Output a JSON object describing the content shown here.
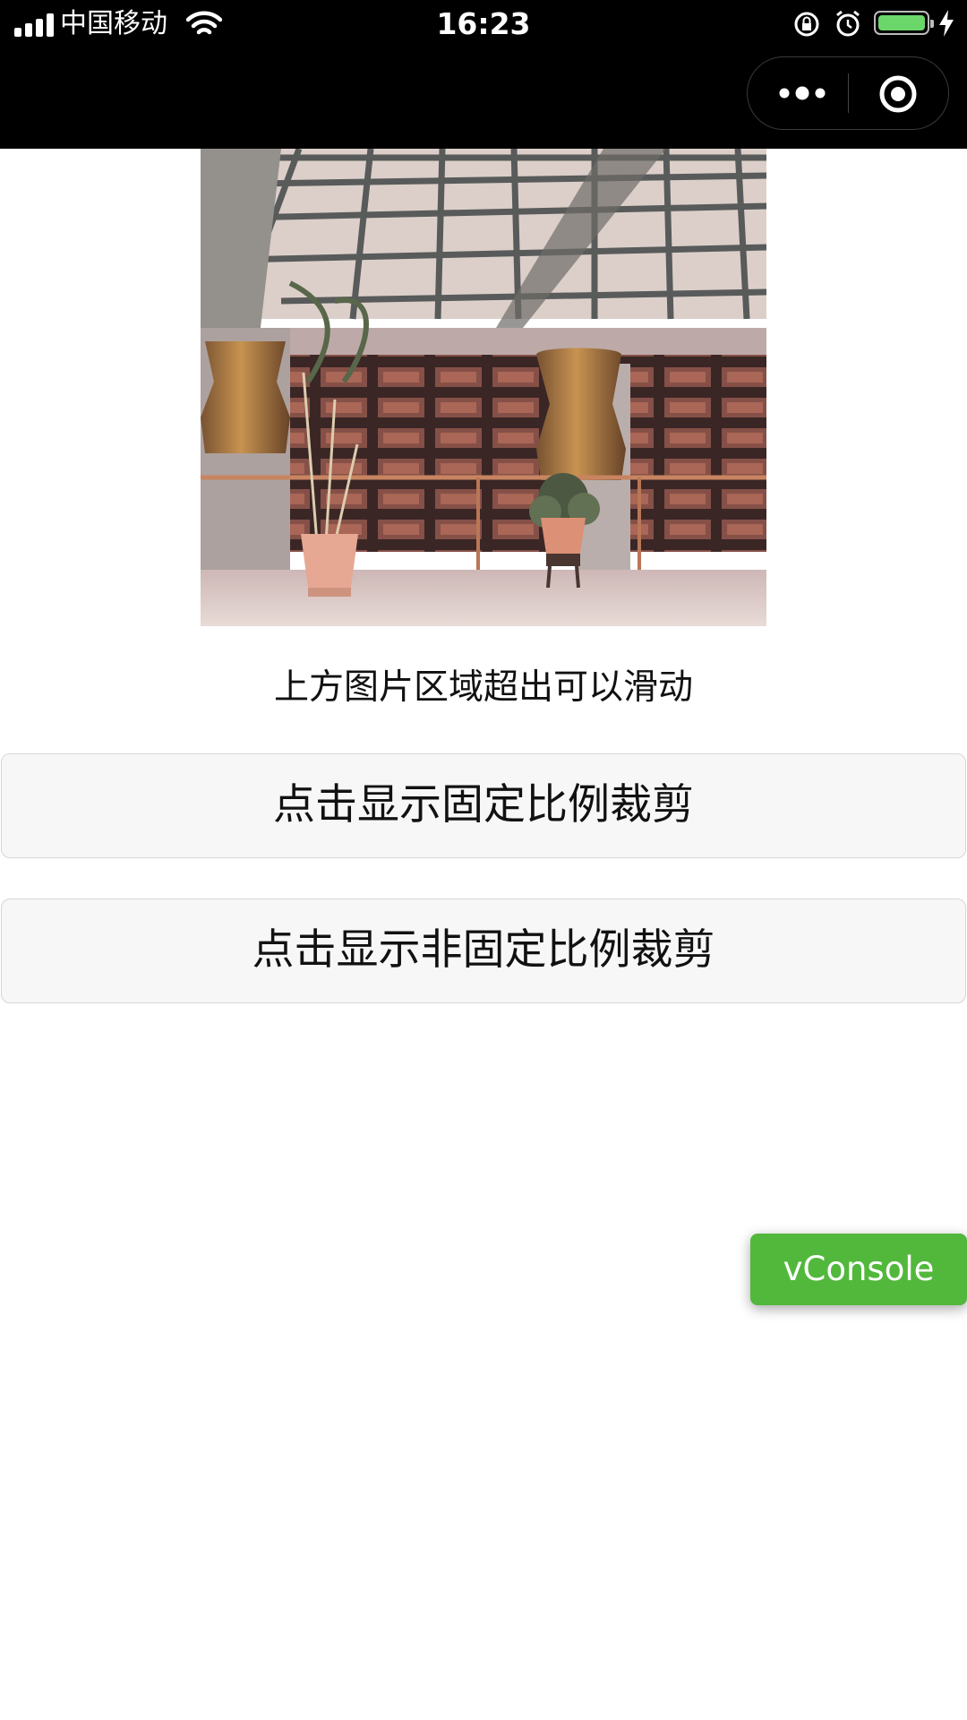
{
  "status_bar": {
    "carrier": "中国移动",
    "time": "16:23",
    "icons": [
      "signal-icon",
      "wifi-icon",
      "rotation-lock-icon",
      "alarm-icon",
      "battery-icon",
      "charging-bolt-icon"
    ],
    "battery_level": 1.0,
    "battery_color": "#6bd66a"
  },
  "capsule": {
    "icons": [
      "more-icon",
      "target-icon"
    ]
  },
  "main": {
    "image": {
      "description_icon": "photo"
    },
    "hint": "上方图片区域超出可以滑动",
    "buttons": [
      {
        "label": "点击显示固定比例裁剪"
      },
      {
        "label": "点击显示非固定比例裁剪"
      }
    ]
  },
  "vconsole": {
    "label": "vConsole",
    "color": "#52b83c"
  }
}
